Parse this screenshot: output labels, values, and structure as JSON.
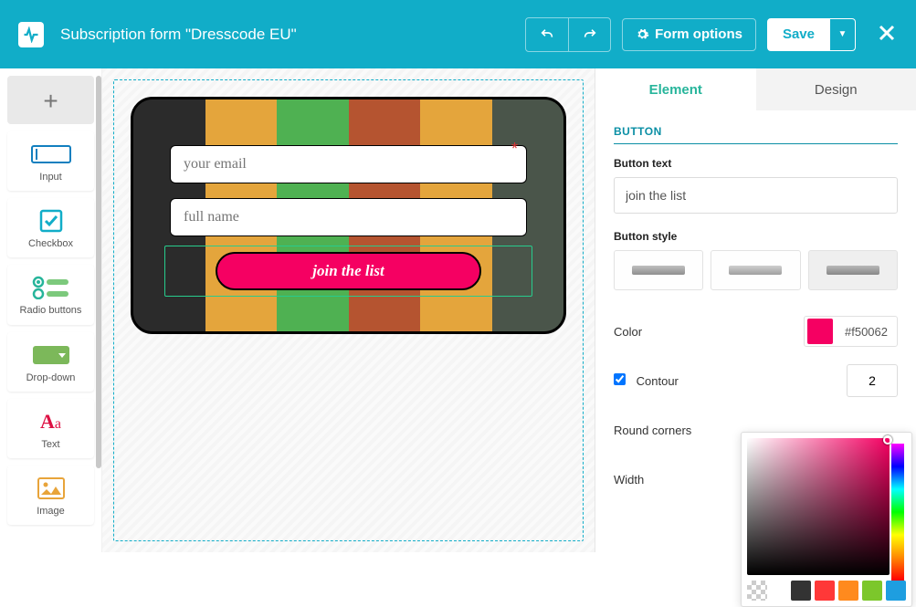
{
  "header": {
    "title": "Subscription form \"Dresscode EU\"",
    "form_options": "Form options",
    "save": "Save"
  },
  "palette": {
    "input": "Input",
    "checkbox": "Checkbox",
    "radio": "Radio buttons",
    "dropdown": "Drop-down",
    "text": "Text",
    "image": "Image"
  },
  "form": {
    "email_placeholder": "your email",
    "name_placeholder": "full name",
    "join_label": "join the list"
  },
  "tabs": {
    "element": "Element",
    "design": "Design"
  },
  "props": {
    "section": "BUTTON",
    "button_text_label": "Button text",
    "button_text_value": "join the list",
    "button_style_label": "Button style",
    "color_label": "Color",
    "color_value": "#f50062",
    "contour_label": "Contour",
    "contour_value": "2",
    "round_label": "Round corners",
    "width_label": "Width"
  },
  "swatches": [
    "#333333",
    "#ff3838",
    "#ff8a1e",
    "#7cc72b",
    "#1e9ee0"
  ]
}
